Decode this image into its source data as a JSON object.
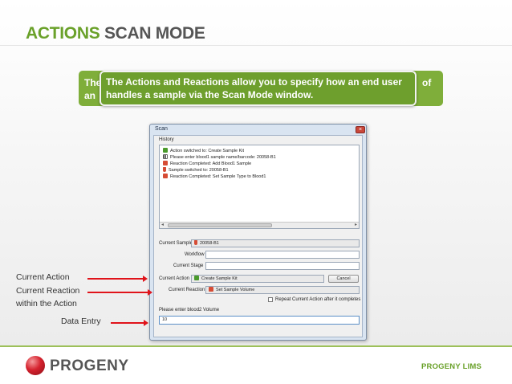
{
  "slide": {
    "title_part1": "ACTIONS",
    "title_part2": "SCAN MODE",
    "callout_back_line1": "The",
    "callout_back_line2": "an",
    "callout_back_right": "of",
    "callout_front_text": "The Actions and Reactions allow you to specify how an end user handles a sample via the Scan Mode window."
  },
  "dialog": {
    "title": "Scan",
    "close_icon": "close-icon",
    "history_label": "History",
    "history": [
      {
        "icon": "green-action-icon",
        "text": "Action switched to: Create Sample Kit"
      },
      {
        "icon": "barcode-icon",
        "text": "Please enter blood1 sample name/barcode: 20058-B1"
      },
      {
        "icon": "red-reaction-icon",
        "text": "Reaction Completed: Add Blood1 Sample"
      },
      {
        "icon": "tube-icon",
        "text": "Sample switched to: 20058-B1"
      },
      {
        "icon": "red-reaction-icon",
        "text": "Reaction Completed: Set Sample Type to Blood1"
      }
    ],
    "current_sample_label": "Current Sample",
    "current_sample_value": "20058-B1",
    "workflow_label": "Workflow",
    "workflow_value": "",
    "current_stage_label": "Current Stage",
    "current_stage_value": "",
    "current_action_label": "Current Action",
    "current_action_value": "Create Sample Kit",
    "cancel_label": "Cancel",
    "current_reaction_label": "Current Reaction",
    "current_reaction_value": "Set Sample Volume",
    "repeat_label": "Repeat Current Action after it completes",
    "prompt_label": "Please enter blood2 Volume",
    "input_value": "10"
  },
  "annotations": {
    "current_action": "Current Action",
    "current_reaction_line1": "Current Reaction",
    "current_reaction_line2": "within the Action",
    "data_entry": "Data Entry"
  },
  "footer": {
    "logo_text": "PROGENY",
    "right_text": "PROGENY LIMS"
  },
  "colors": {
    "accent_green": "#6aa12a",
    "callout_green": "#6e9f2d",
    "arrow_red": "#e0131a",
    "logo_red": "#d5222e"
  }
}
